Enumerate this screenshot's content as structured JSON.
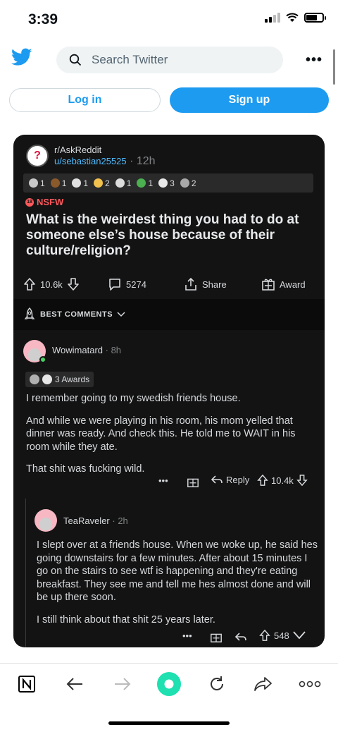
{
  "status": {
    "time": "3:39"
  },
  "header": {
    "search_placeholder": "Search Twitter",
    "more": "•••"
  },
  "auth": {
    "login": "Log in",
    "signup": "Sign up"
  },
  "post": {
    "subreddit": "r/AskReddit",
    "user": "u/sebastian25525",
    "time": "· 12h",
    "awards": [
      "1",
      "1",
      "1",
      "2",
      "1",
      "1",
      "3",
      "2"
    ],
    "nsfw": "NSFW",
    "title": "What is the weirdest thing you had to do at someone else’s house because of their culture/religion?",
    "votes": "10.6k",
    "comments": "5274",
    "share": "Share",
    "award": "Award",
    "sort": "BEST COMMENTS"
  },
  "comment1": {
    "user": "Wowimatard",
    "time": "· 8h",
    "awards": "3 Awards",
    "p1": "I remember going to my swedish friends house.",
    "p2": "And while we were playing in his room, his mom yelled that dinner was ready. And check this. He told me to WAIT in his room while they ate.",
    "p3": "That shit was fucking wild.",
    "dots": "•••",
    "reply": "Reply",
    "votes": "10.4k"
  },
  "comment2": {
    "user": "TeaRaveler",
    "time": "· 2h",
    "p1": "I slept over at a friends house. When we woke up, he said hes going downstairs for a few minutes. After about 15 minutes I go on the stairs to see wtf is happening and they're eating breakfast. They see me and tell me hes almost done and will be up there soon.",
    "p2": "I still think about that shit 25 years later.",
    "dots": "•••",
    "votes": "548"
  },
  "colors": {
    "twitter_blue": "#1d9bf0",
    "card_bg": "#131314",
    "nsfw_red": "#ff585b",
    "link_blue": "#4fbcff"
  },
  "icons": [
    "twitter-bird-icon",
    "search-icon",
    "upvote-icon",
    "downvote-icon",
    "comment-icon",
    "share-icon",
    "award-icon",
    "reply-icon",
    "notion-icon",
    "back-icon",
    "forward-icon",
    "home-icon",
    "reload-icon",
    "share-arrow-icon"
  ]
}
